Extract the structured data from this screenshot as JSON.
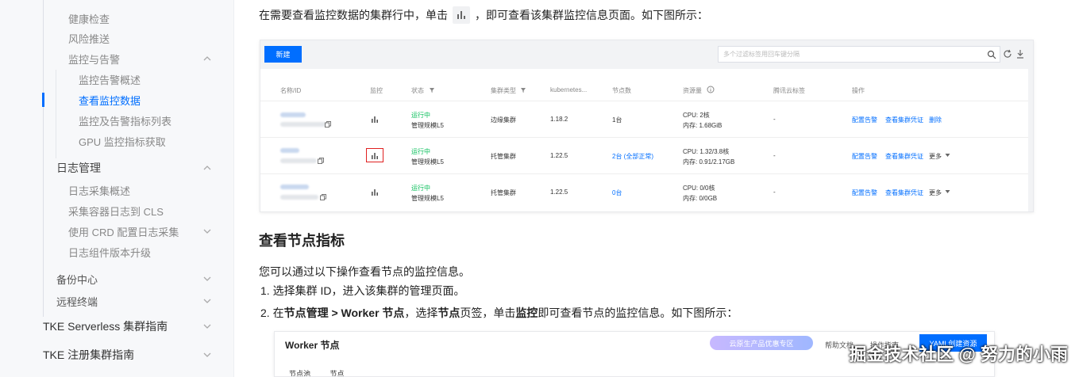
{
  "sidebar": {
    "items": [
      {
        "label": "健康检查"
      },
      {
        "label": "风险推送"
      },
      {
        "label": "监控与告警"
      },
      {
        "label": "监控告警概述"
      },
      {
        "label": "查看监控数据"
      },
      {
        "label": "监控及告警指标列表"
      },
      {
        "label": "GPU 监控指标获取"
      },
      {
        "label": "日志管理"
      },
      {
        "label": "日志采集概述"
      },
      {
        "label": "采集容器日志到 CLS"
      },
      {
        "label": "使用 CRD 配置日志采集"
      },
      {
        "label": "日志组件版本升级"
      },
      {
        "label": "备份中心"
      },
      {
        "label": "远程终端"
      },
      {
        "label": "TKE Serverless 集群指南"
      },
      {
        "label": "TKE 注册集群指南"
      }
    ],
    "accent": "#006eff"
  },
  "content": {
    "intro_before": "在需要查看监控数据的集群行中，单击",
    "intro_after": "，即可查看该集群监控信息页面。如下图所示：",
    "section_title": "查看节点指标",
    "paragraph": "您可以通过以下操作查看节点的监控信息。",
    "step1": "选择集群 ID，进入该集群的管理页面。",
    "step2_a": "在",
    "step2_b": "节点管理 > Worker 节点",
    "step2_c": "，选择",
    "step2_d": "节点",
    "step2_e": "页签，单击",
    "step2_f": "监控",
    "step2_g": "即可查看节点的监控信息。如下图所示：",
    "step1_num": "1.",
    "step2_num": "2."
  },
  "shot1": {
    "new_button": "新建",
    "search_placeholder": "多个过滤标签用回车键分隔",
    "headers": {
      "name": "名称/ID",
      "monitor": "监控",
      "status": "状态",
      "type": "集群类型",
      "k8s": "kubernetes...",
      "nodes": "节点数",
      "resources": "资源量",
      "tags": "腾讯云标签",
      "ops": "操作"
    },
    "rows": [
      {
        "status": "运行中",
        "sub": "管理规模L5",
        "type": "边缘集群",
        "version": "1.18.2",
        "nodes": "1台",
        "cpu": "CPU: 2核",
        "mem": "内存: 1.68GiB",
        "tags": "-",
        "op1": "配置告警",
        "op2": "查看集群凭证",
        "op3": "删除"
      },
      {
        "status": "运行中",
        "sub": "管理规模L5",
        "type": "托管集群",
        "version": "1.22.5",
        "nodes": "2台 (全部正常)",
        "cpu": "CPU: 1.32/3.8核",
        "mem": "内存: 0.91/2.17GB",
        "tags": "-",
        "op1": "配置告警",
        "op2": "查看集群凭证",
        "op3": "更多"
      },
      {
        "status": "运行中",
        "sub": "管理规模L5",
        "type": "托管集群",
        "version": "1.22.5",
        "nodes": "0台",
        "cpu": "CPU: 0/0核",
        "mem": "内存: 0/0GB",
        "tags": "-",
        "op1": "配置告警",
        "op2": "查看集群凭证",
        "op3": "更多"
      }
    ]
  },
  "shot2": {
    "title": "Worker 节点",
    "promo": "云原生产品优惠专区",
    "t1": "帮助文档",
    "t2": "操作指南",
    "yaml": "YAML创建资源",
    "tab1": "节点池",
    "tab2": "节点"
  },
  "watermark": "掘金技术社区 @ 努力的小雨"
}
